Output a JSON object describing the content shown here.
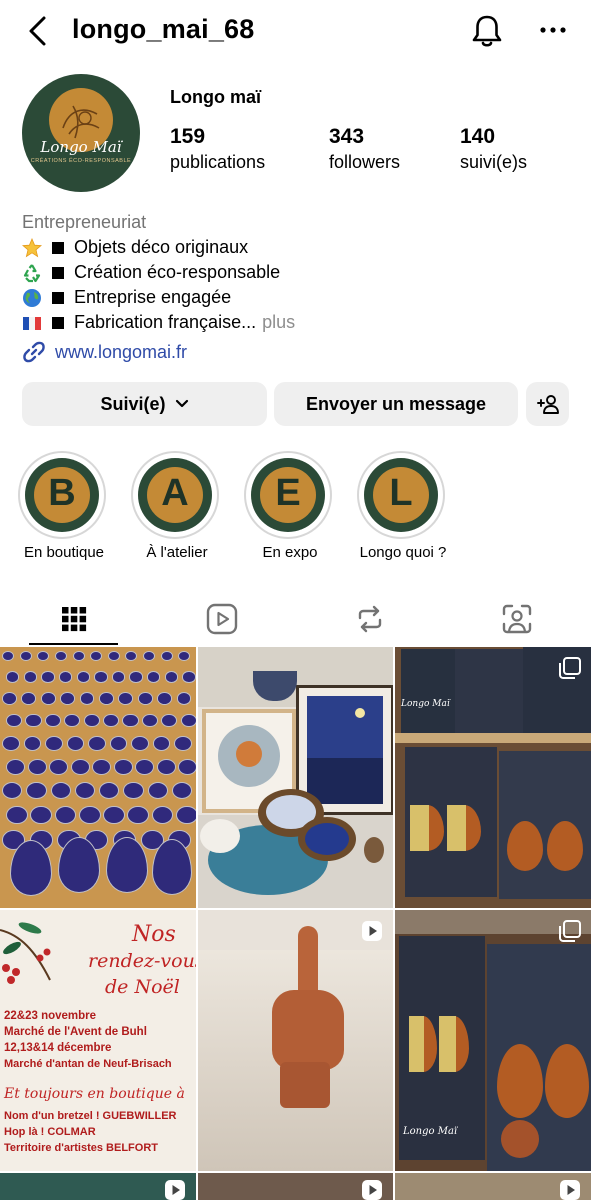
{
  "header": {
    "username": "longo_mai_68"
  },
  "profile": {
    "avatar_script": "Longo Maï",
    "avatar_tagline": "CRÉATIONS ÉCO-RESPONSABLE",
    "display_name": "Longo maï",
    "stats": [
      {
        "value": "159",
        "label": "publications"
      },
      {
        "value": "343",
        "label": "followers"
      },
      {
        "value": "140",
        "label": "suivi(e)s"
      }
    ],
    "category": "Entrepreneuriat",
    "bio_lines": [
      {
        "emoji": "star-emoji",
        "text": "Objets déco originaux"
      },
      {
        "emoji": "recycle-emoji",
        "text": "Création éco-responsable"
      },
      {
        "emoji": "globe-emoji",
        "text": "Entreprise engagée"
      },
      {
        "emoji": "french-flag-emoji",
        "text": "Fabrication française..."
      }
    ],
    "bio_more": "plus",
    "website": "www.longomai.fr"
  },
  "actions": {
    "following_label": "Suivi(e)",
    "message_label": "Envoyer un message"
  },
  "highlights": [
    {
      "letter": "B",
      "label": "En boutique"
    },
    {
      "letter": "A",
      "label": "À l'atelier"
    },
    {
      "letter": "E",
      "label": "En expo"
    },
    {
      "letter": "L",
      "label": "Longo quoi ?"
    }
  ],
  "tabs": [
    "grid-icon",
    "reels-icon",
    "reposts-icon",
    "tagged-icon"
  ],
  "posts": {
    "poster_title_1": "Nos",
    "poster_title_2": "rendez-vous",
    "poster_title_3": "de Noël",
    "poster_lines": [
      "22&23 novembre",
      "Marché de l'Avent de Buhl",
      "12,13&14 décembre",
      "Marché d'antan de Neuf-Brisach"
    ],
    "poster_subtitle": "Et toujours en boutique à",
    "poster_shops": [
      "Nom d'un bretzel ! GUEBWILLER",
      "Hop là ! COLMAR",
      "Territoire d'artistes BELFORT"
    ],
    "card_brand": "Longo Maï"
  },
  "colors": {
    "brand_green": "#2b4a37",
    "brand_gold": "#c48a36",
    "link_blue": "#2f4ba8",
    "button_gray": "#efefef",
    "secondary_text": "#737373"
  }
}
